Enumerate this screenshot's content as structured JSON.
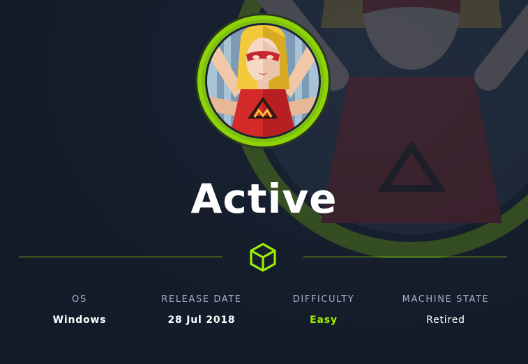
{
  "machine": {
    "name": "Active",
    "avatar_icon": "hero-avatar-icon",
    "divider_icon": "cube-icon"
  },
  "info": {
    "os": {
      "label": "OS",
      "value": "Windows"
    },
    "release_date": {
      "label": "RELEASE DATE",
      "value": "28 Jul 2018"
    },
    "difficulty": {
      "label": "DIFFICULTY",
      "value": "Easy"
    },
    "machine_state": {
      "label": "MACHINE STATE",
      "value": "Retired"
    }
  },
  "colors": {
    "background": "#141d2b",
    "accent": "#9fef00",
    "label": "#a4b1cd",
    "text": "#ffffff"
  }
}
